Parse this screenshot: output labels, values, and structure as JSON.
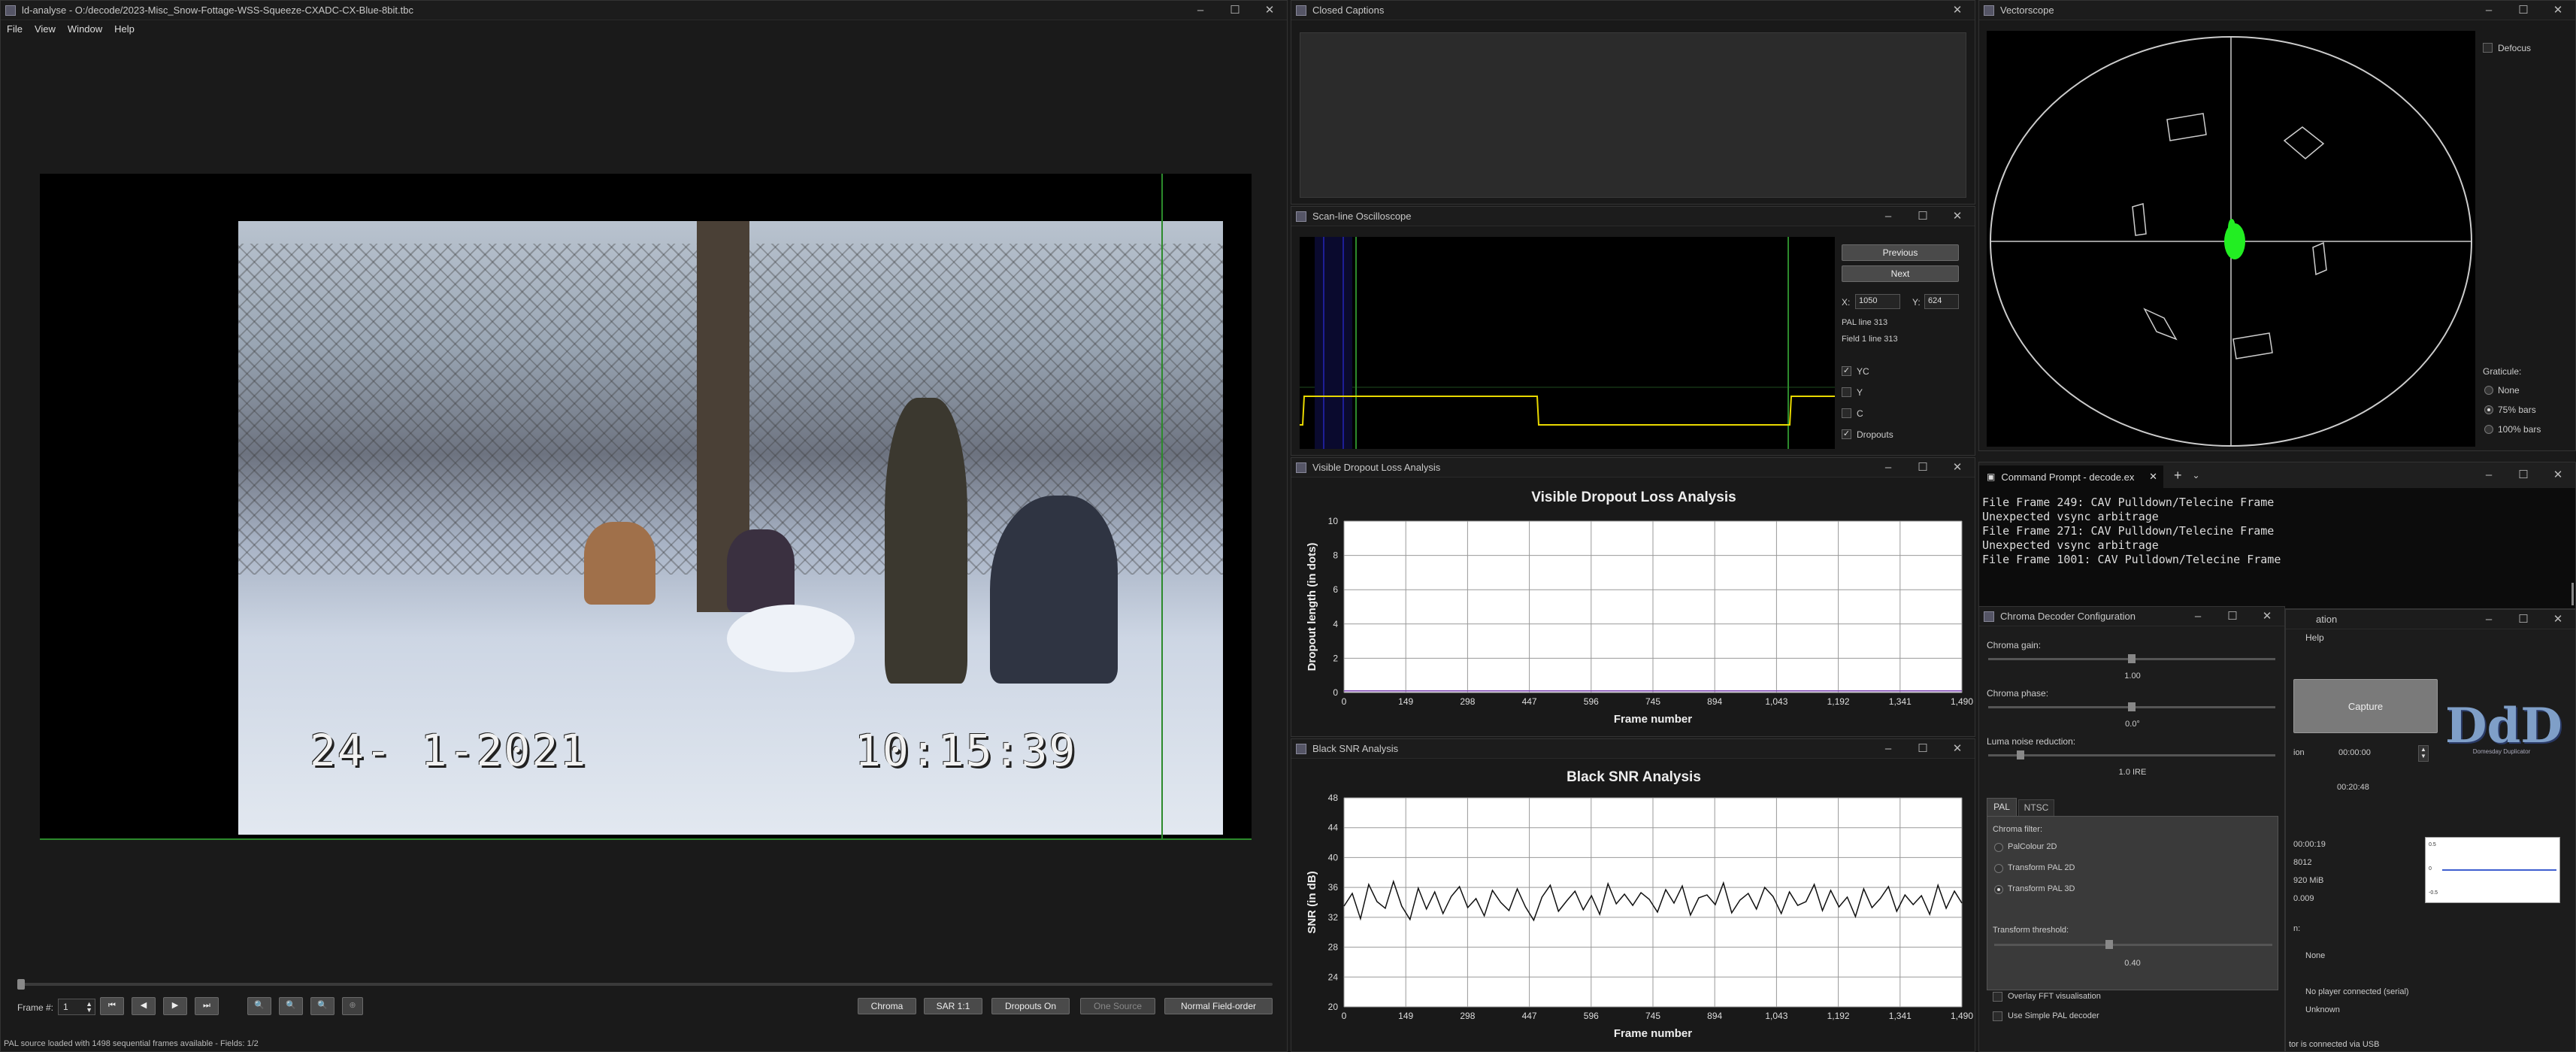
{
  "main": {
    "title": "ld-analyse - O:/decode/2023-Misc_Snow-Fottage-WSS-Squeeze-CXADC-CX-Blue-8bit.tbc",
    "menu": [
      "File",
      "View",
      "Window",
      "Help"
    ],
    "osd_date": "24- 1-2021",
    "osd_time": "10:15:39",
    "frame_label": "Frame #:",
    "frame_value": "1",
    "buttons": {
      "chroma": "Chroma",
      "sar": "SAR 1:1",
      "dropouts": "Dropouts On",
      "one_source": "One Source",
      "field_order": "Normal Field-order"
    },
    "status": "PAL source loaded with 1498 sequential frames available  -  Fields: 1/2"
  },
  "cc": {
    "title": "Closed Captions"
  },
  "scope": {
    "title": "Scan-line Oscilloscope",
    "prev": "Previous",
    "next": "Next",
    "x_label": "X:",
    "x_value": "1050",
    "y_label": "Y:",
    "y_value": "624",
    "pal_line": "PAL line 313",
    "field_line": "Field 1 line 313",
    "opts": [
      {
        "label": "YC",
        "checked": true
      },
      {
        "label": "Y",
        "checked": false
      },
      {
        "label": "C",
        "checked": false
      },
      {
        "label": "Dropouts",
        "checked": true
      }
    ]
  },
  "vector": {
    "title": "Vectorscope",
    "defocus": "Defocus",
    "graticule": "Graticule:",
    "grat_opts": [
      {
        "label": "None",
        "on": false
      },
      {
        "label": "75% bars",
        "on": true
      },
      {
        "label": "100% bars",
        "on": false
      }
    ]
  },
  "terminal": {
    "tab_title": "Command Prompt - decode.ex",
    "lines": [
      "File Frame 249: CAV Pulldown/Telecine Frame",
      "Unexpected vsync arbitrage",
      "File Frame 271: CAV Pulldown/Telecine Frame",
      "Unexpected vsync arbitrage",
      "File Frame 1001: CAV Pulldown/Telecine Frame"
    ]
  },
  "dropout": {
    "title": "Visible Dropout Loss Analysis"
  },
  "snr": {
    "title": "Black SNR Analysis"
  },
  "chroma": {
    "title": "Chroma Decoder Configuration",
    "gain_label": "Chroma gain:",
    "gain_value": "1.00",
    "phase_label": "Chroma phase:",
    "phase_value": "0.0°",
    "luma_label": "Luma noise reduction:",
    "luma_value": "1.0 IRE",
    "tabs": [
      "PAL",
      "NTSC"
    ],
    "filter_label": "Chroma filter:",
    "filters": [
      {
        "label": "PalColour 2D",
        "on": false
      },
      {
        "label": "Transform PAL 2D",
        "on": false
      },
      {
        "label": "Transform PAL 3D",
        "on": true
      }
    ],
    "threshold_label": "Transform threshold:",
    "threshold_value": "0.40",
    "overlay": "Overlay FFT visualisation",
    "simple": "Use Simple PAL decoder"
  },
  "capture": {
    "title_fragment": "ation",
    "menu": "Help",
    "capture_btn": "Capture",
    "dur_label": "ion",
    "time1": "00:00:00",
    "time2": "00:20:48",
    "stat1": "00:00:19",
    "stat2": "8012",
    "stat3": "920 MiB",
    "stat4": "0.009",
    "graph_ticks": [
      "0.5",
      "0",
      "-0.5"
    ],
    "m_label": "n:",
    "none": "None",
    "player": "No player connected (serial)",
    "unknown": "Unknown",
    "usb": "tor is connected via USB",
    "logo": "DdD",
    "logo_sub": "Domesday Duplicator"
  },
  "chart_data": [
    {
      "type": "line",
      "title": "Visible Dropout Loss Analysis",
      "xlabel": "Frame number",
      "ylabel": "Dropout length (in dots)",
      "xlim": [
        0,
        1498
      ],
      "ylim": [
        0,
        10
      ],
      "xticks": [
        "0",
        "149",
        "298",
        "447",
        "596",
        "745",
        "894",
        "1,043",
        "1,192",
        "1,341",
        "1,490"
      ],
      "yticks": [
        "0",
        "2",
        "4",
        "6",
        "8",
        "10"
      ],
      "series": [
        {
          "values": [
            [
              0,
              0.1
            ],
            [
              200,
              0.1
            ],
            [
              400,
              0.1
            ],
            [
              600,
              0.1
            ],
            [
              800,
              0.1
            ],
            [
              1000,
              0.1
            ],
            [
              1200,
              0.1
            ],
            [
              1400,
              0.1
            ],
            [
              1498,
              0.1
            ]
          ]
        }
      ]
    },
    {
      "type": "line",
      "title": "Black SNR Analysis",
      "xlabel": "Frame number",
      "ylabel": "SNR (in dB)",
      "xlim": [
        0,
        1498
      ],
      "ylim": [
        20,
        48
      ],
      "xticks": [
        "0",
        "149",
        "298",
        "447",
        "596",
        "745",
        "894",
        "1,043",
        "1,192",
        "1,341",
        "1,490"
      ],
      "yticks": [
        "20",
        "24",
        "28",
        "32",
        "36",
        "40",
        "44",
        "48"
      ],
      "series": [
        {
          "values": [
            [
              0,
              33.5
            ],
            [
              20,
              35.2
            ],
            [
              40,
              31.8
            ],
            [
              60,
              36.4
            ],
            [
              80,
              34.1
            ],
            [
              100,
              33.2
            ],
            [
              120,
              36.8
            ],
            [
              140,
              33.5
            ],
            [
              160,
              31.7
            ],
            [
              180,
              35.9
            ],
            [
              200,
              33.1
            ],
            [
              220,
              35.4
            ],
            [
              240,
              32.5
            ],
            [
              260,
              34.8
            ],
            [
              280,
              36.1
            ],
            [
              300,
              33.3
            ],
            [
              320,
              34.5
            ],
            [
              340,
              32.2
            ],
            [
              360,
              35.6
            ],
            [
              380,
              34.0
            ],
            [
              400,
              32.9
            ],
            [
              420,
              35.8
            ],
            [
              440,
              33.4
            ],
            [
              460,
              31.6
            ],
            [
              480,
              34.7
            ],
            [
              500,
              36.3
            ],
            [
              520,
              32.8
            ],
            [
              540,
              34.2
            ],
            [
              560,
              35.5
            ],
            [
              580,
              33.0
            ],
            [
              600,
              34.9
            ],
            [
              620,
              32.4
            ],
            [
              640,
              36.5
            ],
            [
              660,
              33.8
            ],
            [
              680,
              35.1
            ],
            [
              700,
              33.6
            ],
            [
              720,
              35.3
            ],
            [
              740,
              34.4
            ],
            [
              760,
              32.7
            ],
            [
              780,
              35.7
            ],
            [
              800,
              33.9
            ],
            [
              820,
              36.2
            ],
            [
              840,
              32.3
            ],
            [
              860,
              34.6
            ],
            [
              880,
              35.0
            ],
            [
              900,
              33.7
            ],
            [
              920,
              36.6
            ],
            [
              940,
              32.6
            ],
            [
              960,
              34.3
            ],
            [
              980,
              35.2
            ],
            [
              1000,
              33.1
            ],
            [
              1020,
              36.0
            ],
            [
              1040,
              34.8
            ],
            [
              1060,
              32.5
            ],
            [
              1080,
              35.4
            ],
            [
              1100,
              33.6
            ],
            [
              1120,
              34.1
            ],
            [
              1140,
              36.4
            ],
            [
              1160,
              32.9
            ],
            [
              1180,
              35.6
            ],
            [
              1200,
              33.4
            ],
            [
              1220,
              34.7
            ],
            [
              1240,
              32.1
            ],
            [
              1260,
              35.8
            ],
            [
              1280,
              33.3
            ],
            [
              1300,
              34.5
            ],
            [
              1320,
              36.1
            ],
            [
              1340,
              32.8
            ],
            [
              1360,
              35.0
            ],
            [
              1380,
              33.7
            ],
            [
              1400,
              34.9
            ],
            [
              1420,
              32.4
            ],
            [
              1440,
              36.3
            ],
            [
              1460,
              33.2
            ],
            [
              1480,
              35.5
            ],
            [
              1498,
              33.9
            ]
          ]
        }
      ]
    }
  ]
}
